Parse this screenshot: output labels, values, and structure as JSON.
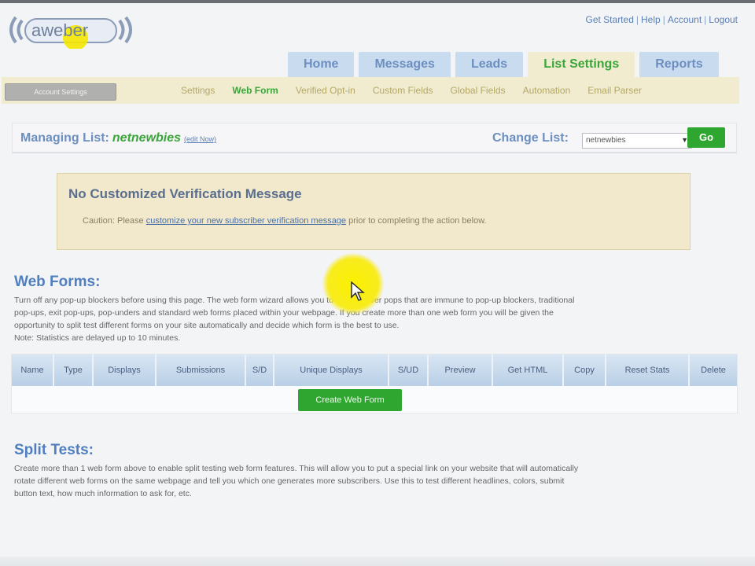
{
  "header": {
    "logo_text": "aweber",
    "top_links": [
      "Get Started",
      "Help",
      "Account",
      "Logout"
    ]
  },
  "main_tabs": [
    {
      "label": "Home",
      "active": false
    },
    {
      "label": "Messages",
      "active": false
    },
    {
      "label": "Leads",
      "active": false
    },
    {
      "label": "List Settings",
      "active": true
    },
    {
      "label": "Reports",
      "active": false
    }
  ],
  "subnav": {
    "account_button": "Account Settings",
    "items": [
      {
        "label": "Settings",
        "active": false
      },
      {
        "label": "Web Form",
        "active": true
      },
      {
        "label": "Verified Opt-in",
        "active": false
      },
      {
        "label": "Custom Fields",
        "active": false
      },
      {
        "label": "Global Fields",
        "active": false
      },
      {
        "label": "Automation",
        "active": false
      },
      {
        "label": "Email Parser",
        "active": false
      }
    ]
  },
  "manage": {
    "label": "Managing List:",
    "list_name": "netnewbies",
    "edit_link": "(edit Now)",
    "change_label": "Change List:",
    "selected_list": "netnewbies",
    "go_label": "Go"
  },
  "warning": {
    "title": "No Customized Verification Message",
    "prefix": "Caution: Please ",
    "link": "customize your new subscriber verification message",
    "suffix": " prior to completing the action below."
  },
  "web_forms": {
    "title": "Web Forms:",
    "lines": [
      "Turn off any pop-up blockers before using this page. The web form wizard allows you to create hover pops that are immune to pop-up blockers, traditional",
      "pop-ups, exit pop-ups, pop-unders and standard web forms placed within your webpage. If you create more than one web form you will be given the",
      "opportunity to split test different forms on your site automatically and decide which form is the best to use.",
      "Note: Statistics are delayed up to 10 minutes."
    ],
    "columns": [
      "Name",
      "Type",
      "Displays",
      "Submissions",
      "S/D",
      "Unique Displays",
      "S/UD",
      "Preview",
      "Get HTML",
      "Copy",
      "Reset Stats",
      "Delete"
    ],
    "create_button": "Create Web Form"
  },
  "split_tests": {
    "title": "Split Tests:",
    "lines": [
      "Create more than 1 web form above to enable split testing web form features. This will allow you to put a special link on your website that will automatically",
      "rotate different web forms on the same webpage and tell you which one generates more subscribers. Use this to test different headlines, colors, submit",
      "button text, how much information to ask for, etc."
    ]
  },
  "colors": {
    "accent_blue": "#4f7fbf",
    "accent_green": "#2fa62f",
    "tab_blue": "#c9dbef",
    "beige": "#f1ecd0"
  }
}
